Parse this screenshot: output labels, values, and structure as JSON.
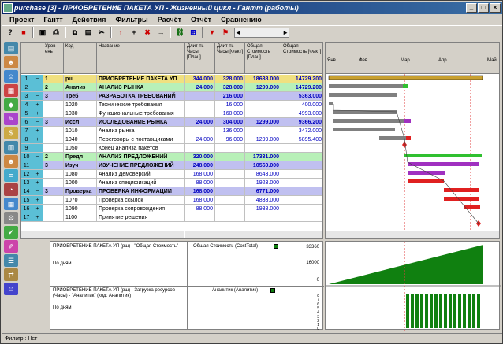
{
  "window": {
    "title": "purchase [3] - ПРИОБРЕТЕНИЕ ПАКЕТА УП - Жизненный цикл - Гантт (работы)"
  },
  "menu": [
    "Проект",
    "Гантт",
    "Действия",
    "Фильтры",
    "Расчёт",
    "Отчёт",
    "Сравнению"
  ],
  "grid": {
    "headers": {
      "level": "Уров ень",
      "code": "Код",
      "name": "Название",
      "dur_plan": "Длит-ть Часы [План]",
      "dur_fact": "Длит-ть Часы [Факт]",
      "cost_plan": "Общая Стоимость [План]",
      "cost_fact": "Общая Стоимость [Факт]"
    },
    "rows": [
      {
        "n": "1",
        "sign": "−",
        "lvl": "1",
        "code": "рш",
        "name": "ПРИОБРЕТЕНИЕ ПАКЕТА УП",
        "dp": "344.000",
        "df": "328.000",
        "cp": "18638.000",
        "cf": "14729.200",
        "bg": "#f0e080",
        "bold": true
      },
      {
        "n": "2",
        "sign": "−",
        "lvl": "2",
        "code": "Анализ",
        "name": "АНАЛИЗ РЫНКА",
        "dp": "24.000",
        "df": "328.000",
        "cp": "1299.000",
        "cf": "14729.200",
        "bg": "#b8f0b8",
        "bold": true
      },
      {
        "n": "3",
        "sign": "−",
        "lvl": "3",
        "code": "Треб",
        "name": "РАЗРАБОТКА ТРЕБОВАНИЙ",
        "dp": "",
        "df": "216.000",
        "cp": "",
        "cf": "5363.000",
        "bg": "#c0c0f0",
        "bold": true
      },
      {
        "n": "4",
        "sign": "+",
        "lvl": "",
        "code": "1020",
        "name": "Технические требования",
        "dp": "",
        "df": "16.000",
        "cp": "",
        "cf": "400.000",
        "bg": "#ffffff",
        "bold": false
      },
      {
        "n": "5",
        "sign": "+",
        "lvl": "",
        "code": "1030",
        "name": "Функциональные требования",
        "dp": "",
        "df": "160.000",
        "cp": "",
        "cf": "4993.000",
        "bg": "#ffffff",
        "bold": false
      },
      {
        "n": "6",
        "sign": "−",
        "lvl": "3",
        "code": "Иссл",
        "name": "ИССЛЕДОВАНИЕ РЫНКА",
        "dp": "24.000",
        "df": "304.000",
        "cp": "1299.000",
        "cf": "9366.200",
        "bg": "#c0c0f0",
        "bold": true
      },
      {
        "n": "7",
        "sign": "+",
        "lvl": "",
        "code": "1010",
        "name": "Анализ рынка",
        "dp": "",
        "df": "136.000",
        "cp": "",
        "cf": "3472.000",
        "bg": "#ffffff",
        "bold": false
      },
      {
        "n": "8",
        "sign": "+",
        "lvl": "",
        "code": "1040",
        "name": "Переговоры с поставщиками",
        "dp": "24.000",
        "df": "96.000",
        "cp": "1299.000",
        "cf": "5895.400",
        "bg": "#ffffff",
        "bold": false
      },
      {
        "n": "9",
        "sign": "",
        "lvl": "",
        "code": "1050",
        "name": "Конец анализа пакетов",
        "dp": "",
        "df": "",
        "cp": "",
        "cf": "",
        "bg": "#ffffff",
        "bold": false
      },
      {
        "n": "10",
        "sign": "−",
        "lvl": "2",
        "code": "Предл",
        "name": "АНАЛИЗ ПРЕДЛОЖЕНИЙ",
        "dp": "320.000",
        "df": "",
        "cp": "17331.000",
        "cf": "",
        "bg": "#b8f0b8",
        "bold": true
      },
      {
        "n": "11",
        "sign": "−",
        "lvl": "3",
        "code": "Изуч",
        "name": "ИЗУЧЕНИЕ ПРЕДЛОЖЕНИЙ",
        "dp": "248.000",
        "df": "",
        "cp": "10560.000",
        "cf": "",
        "bg": "#c0c0f0",
        "bold": true
      },
      {
        "n": "12",
        "sign": "+",
        "lvl": "",
        "code": "1080",
        "name": "Анализ Демоверсий",
        "dp": "168.000",
        "df": "",
        "cp": "8643.000",
        "cf": "",
        "bg": "#ffffff",
        "bold": false
      },
      {
        "n": "13",
        "sign": "+",
        "lvl": "",
        "code": "1000",
        "name": "Анализ спецификаций",
        "dp": "88.000",
        "df": "",
        "cp": "1923.000",
        "cf": "",
        "bg": "#ffffff",
        "bold": false
      },
      {
        "n": "14",
        "sign": "−",
        "lvl": "3",
        "code": "Проверка",
        "name": "ПРОВЕРКА ИНФОРМАЦИИ",
        "dp": "168.000",
        "df": "",
        "cp": "6771.000",
        "cf": "",
        "bg": "#c0c0f0",
        "bold": true
      },
      {
        "n": "15",
        "sign": "+",
        "lvl": "",
        "code": "1070",
        "name": "Проверка ссылок",
        "dp": "168.000",
        "df": "",
        "cp": "4833.000",
        "cf": "",
        "bg": "#ffffff",
        "bold": false
      },
      {
        "n": "16",
        "sign": "+",
        "lvl": "",
        "code": "1090",
        "name": "Проверка сопровождения",
        "dp": "88.000",
        "df": "",
        "cp": "1938.000",
        "cf": "",
        "bg": "#ffffff",
        "bold": false
      },
      {
        "n": "17",
        "sign": "+",
        "lvl": "",
        "code": "1100",
        "name": "Принятие решения",
        "dp": "",
        "df": "",
        "cp": "",
        "cf": "",
        "bg": "#ffffff",
        "bold": false
      }
    ]
  },
  "gantt": {
    "months": [
      "Янв",
      "Фев",
      "Мар",
      "Апр",
      "Май"
    ]
  },
  "bottom": {
    "chart1_label": "ПРИОБРЕТЕНИЕ ПАКЕТА УП (рш) - \"Общая Стоимость\"",
    "chart1_sub": "По дням",
    "chart1_legend": "Общая Стоимость (CostTotal)",
    "chart1_ticks": [
      "33360",
      "16000",
      "0"
    ],
    "chart2_label": "ПРИОБРЕТЕНИЕ ПАКЕТА УП (рш) - Загрузка ресурсов (Часы) - \"Аналитик\" (код: Аналитик)",
    "chart2_sub": "По дням",
    "chart2_legend": "Аналитик (Аналитик)",
    "chart2_ticks": [
      "8",
      "7",
      "6",
      "5",
      "4",
      "3",
      "2",
      "1",
      "0"
    ]
  },
  "status": {
    "filter": "Фильтр : Нет"
  }
}
